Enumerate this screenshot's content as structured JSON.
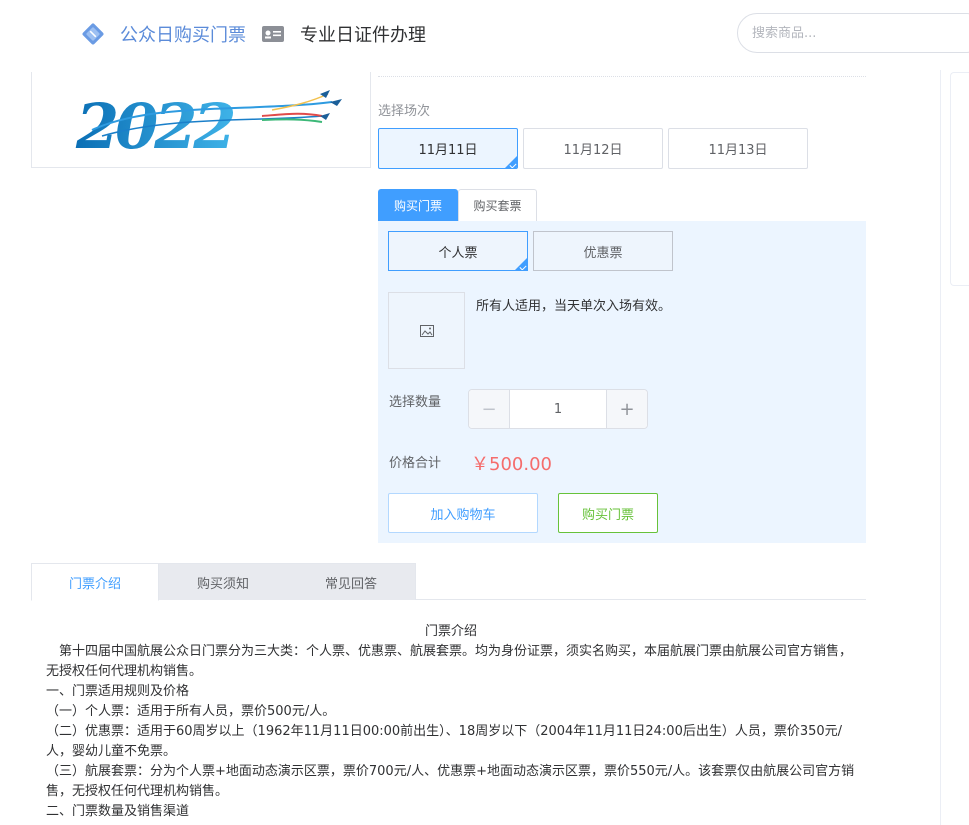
{
  "header": {
    "nav_public_label": "公众日购买门票",
    "nav_professional_label": "专业日证件办理",
    "search_placeholder": "搜索商品...",
    "public_icon": "diamond-ticket-icon",
    "professional_icon": "id-card-icon"
  },
  "product": {
    "poster_text": "2022",
    "session_label": "选择场次",
    "sessions": [
      {
        "label": "11月11日",
        "selected": true
      },
      {
        "label": "11月12日",
        "selected": false
      },
      {
        "label": "11月13日",
        "selected": false
      }
    ],
    "buy_tabs": [
      {
        "label": "购买门票",
        "active": true
      },
      {
        "label": "购买套票",
        "active": false
      }
    ],
    "ticket_types": [
      {
        "label": "个人票",
        "selected": true
      },
      {
        "label": "优惠票",
        "selected": false
      }
    ],
    "ticket_description": "所有人适用，当天单次入场有效。",
    "quantity_label": "选择数量",
    "quantity": "1",
    "price_label": "价格合计",
    "price": "￥500.00",
    "add_to_cart_label": "加入购物车",
    "buy_label": "购买门票"
  },
  "info_tabs": [
    {
      "label": "门票介绍",
      "active": true
    },
    {
      "label": "购买须知",
      "active": false
    },
    {
      "label": "常见回答",
      "active": false
    }
  ],
  "article": {
    "title": "门票介绍",
    "paragraphs": [
      "　第十四届中国航展公众日门票分为三大类：个人票、优惠票、航展套票。均为身份证票，须实名购买，本届航展门票由航展公司官方销售，无授权任何代理机构销售。",
      "一、门票适用规则及价格",
      "（一）个人票：适用于所有人员，票价500元/人。",
      "（二）优惠票：适用于60周岁以上（1962年11月11日00:00前出生）、18周岁以下（2004年11月11日24:00后出生）人员，票价350元/人，婴幼儿童不免票。",
      "（三）航展套票：分为个人票+地面动态演示区票，票价700元/人、优惠票+地面动态演示区票，票价550元/人。该套票仅由航展公司官方销售，无授权任何代理机构销售。",
      "二、门票数量及销售渠道"
    ]
  },
  "colors": {
    "primary": "#409eff",
    "price": "#f56c6c",
    "success": "#67c23a",
    "panel_bg": "#ecf5ff"
  }
}
